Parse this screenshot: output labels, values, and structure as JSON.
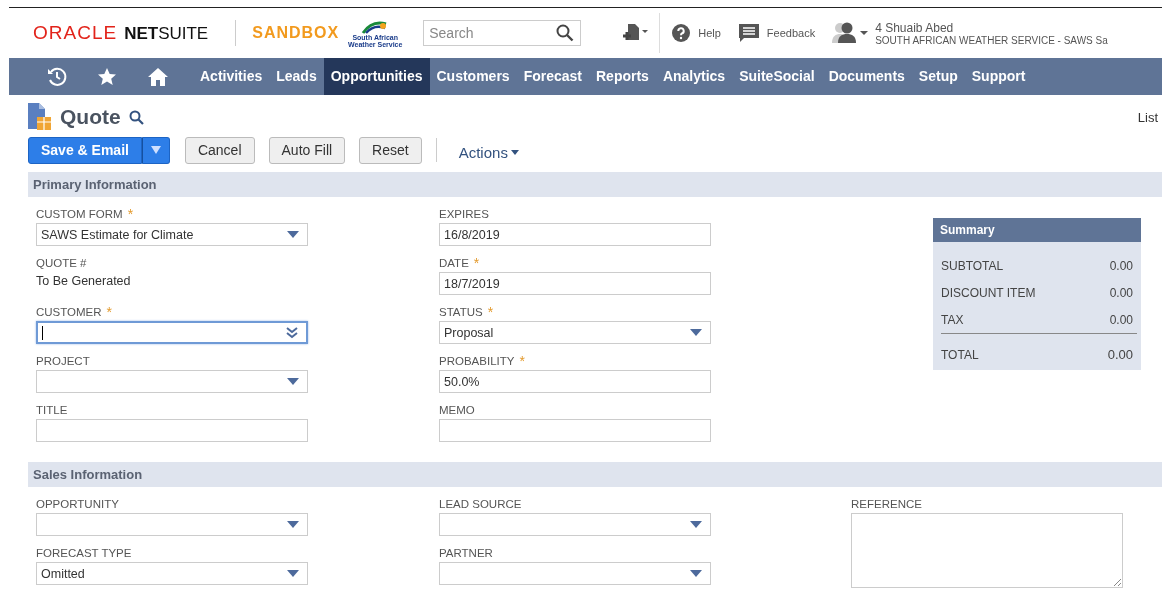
{
  "header": {
    "brand_oracle": "ORACLE",
    "brand_net": "NET",
    "brand_suite": "SUITE",
    "environment": "SANDBOX",
    "org_logo_text": "South African Weather Service",
    "search": {
      "placeholder": "Search"
    },
    "help": "Help",
    "feedback": "Feedback",
    "user_name": "4 Shuaib Abed",
    "user_account": "SOUTH AFRICAN WEATHER SERVICE - SAWS Sa"
  },
  "nav": [
    {
      "label": "Activities",
      "selected": false
    },
    {
      "label": "Leads",
      "selected": false
    },
    {
      "label": "Opportunities",
      "selected": true
    },
    {
      "label": "Customers",
      "selected": false
    },
    {
      "label": "Forecast",
      "selected": false
    },
    {
      "label": "Reports",
      "selected": false
    },
    {
      "label": "Analytics",
      "selected": false
    },
    {
      "label": "SuiteSocial",
      "selected": false
    },
    {
      "label": "Documents",
      "selected": false
    },
    {
      "label": "Setup",
      "selected": false
    },
    {
      "label": "Support",
      "selected": false
    }
  ],
  "page": {
    "title": "Quote",
    "list_link": "List"
  },
  "buttons": [
    {
      "label": "Save & Email",
      "kind": "primary"
    },
    {
      "label": "Cancel",
      "kind": "plain"
    },
    {
      "label": "Auto Fill",
      "kind": "plain"
    },
    {
      "label": "Reset",
      "kind": "plain"
    }
  ],
  "actions": "Actions",
  "primary": {
    "title": "Primary Information",
    "columns": [
      [
        {
          "label": "CUSTOM FORM",
          "required_mark": "*",
          "kind": "select",
          "value": "SAWS Estimate for Climate"
        },
        {
          "label": "QUOTE #",
          "kind": "static",
          "value": "To Be Generated"
        },
        {
          "label": "CUSTOMER",
          "required_mark": "*",
          "kind": "combo",
          "focused": true
        },
        {
          "label": "PROJECT",
          "kind": "select"
        },
        {
          "label": "TITLE",
          "kind": "text"
        }
      ],
      [
        {
          "label": "EXPIRES",
          "kind": "text",
          "value": "16/8/2019"
        },
        {
          "label": "DATE",
          "required_mark": "*",
          "kind": "text",
          "value": "18/7/2019"
        },
        {
          "label": "STATUS",
          "required_mark": "*",
          "kind": "select",
          "value": "Proposal"
        },
        {
          "label": "PROBABILITY",
          "required_mark": "*",
          "kind": "text",
          "value": "50.0%"
        },
        {
          "label": "MEMO",
          "kind": "text"
        }
      ]
    ],
    "summary": {
      "title": "Summary",
      "rows": [
        {
          "label": "SUBTOTAL",
          "value": "0.00"
        },
        {
          "label": "DISCOUNT ITEM",
          "value": "0.00"
        },
        {
          "label": "TAX",
          "value": "0.00"
        }
      ],
      "total": {
        "label": "TOTAL",
        "value": "0.00"
      }
    }
  },
  "sales": {
    "title": "Sales Information",
    "columns": [
      [
        {
          "label": "OPPORTUNITY",
          "kind": "select"
        },
        {
          "label": "FORECAST TYPE",
          "kind": "select",
          "value": "Omitted"
        }
      ],
      [
        {
          "label": "LEAD SOURCE",
          "kind": "select"
        },
        {
          "label": "PARTNER",
          "kind": "select"
        }
      ],
      [
        {
          "label": "REFERENCE",
          "kind": "textarea"
        }
      ]
    ]
  }
}
